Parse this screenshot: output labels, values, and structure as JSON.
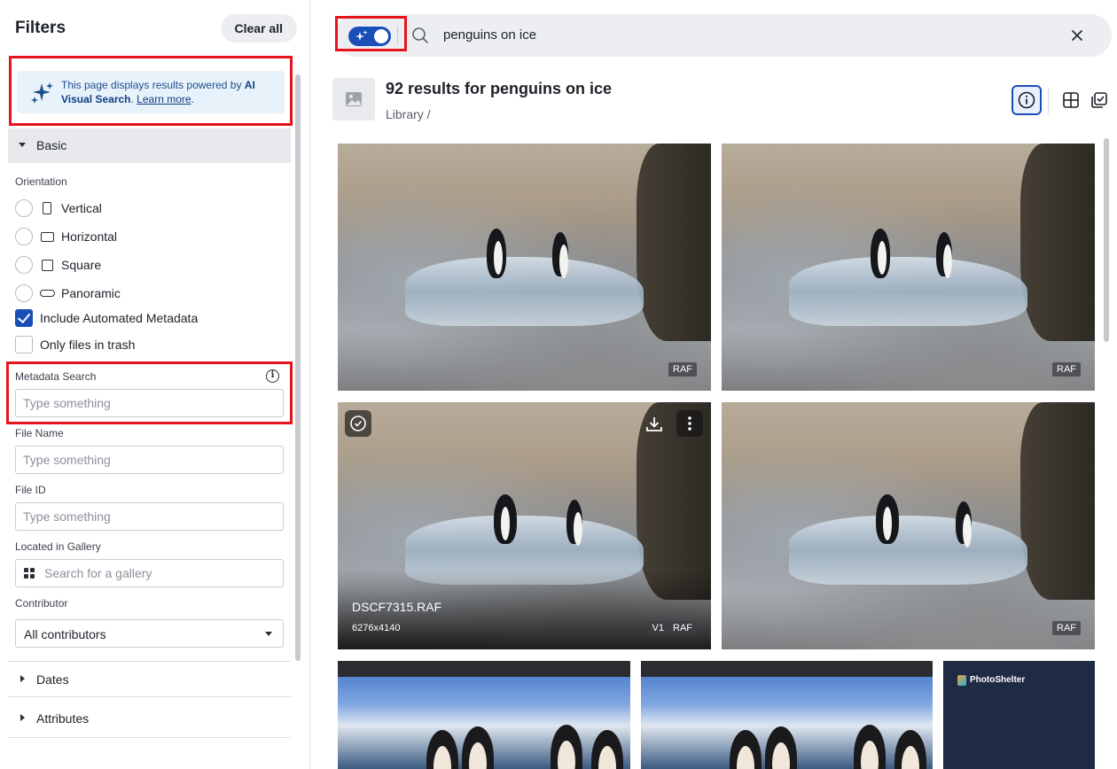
{
  "sidebar": {
    "title": "Filters",
    "clear_all": "Clear all",
    "ai_notice": {
      "prefix": "This page displays results powered by ",
      "highlight": "AI Visual Search",
      "separator": ". ",
      "link": "Learn more",
      "suffix": "."
    },
    "basic_section": "Basic",
    "orientation_label": "Orientation",
    "orientation_options": [
      "Vertical",
      "Horizontal",
      "Square",
      "Panoramic"
    ],
    "include_automated_metadata": "Include Automated Metadata",
    "only_files_in_trash": "Only files in trash",
    "metadata_search_label": "Metadata Search",
    "metadata_search_placeholder": "Type something",
    "file_name_label": "File Name",
    "file_name_placeholder": "Type something",
    "file_id_label": "File ID",
    "file_id_placeholder": "Type something",
    "gallery_label": "Located in Gallery",
    "gallery_placeholder": "Search for a gallery",
    "contributor_label": "Contributor",
    "contributor_value": "All contributors",
    "dates_section": "Dates",
    "attributes_section": "Attributes"
  },
  "search": {
    "query": "penguins on ice"
  },
  "results": {
    "title": "92 results for penguins on ice",
    "breadcrumb": "Library /"
  },
  "tiles": [
    {
      "badge": "RAF"
    },
    {
      "badge": "RAF"
    },
    {
      "name": "DSCF7315.RAF",
      "dimensions": "6276x4140",
      "version": "V1",
      "badge": "RAF"
    },
    {
      "badge": "RAF"
    },
    {},
    {},
    {
      "brand": "PhotoShelter"
    }
  ],
  "colors": {
    "accent": "#1a4fb8",
    "highlight_box": "#e8141d",
    "ai_notice_bg": "#e8f2fb"
  }
}
